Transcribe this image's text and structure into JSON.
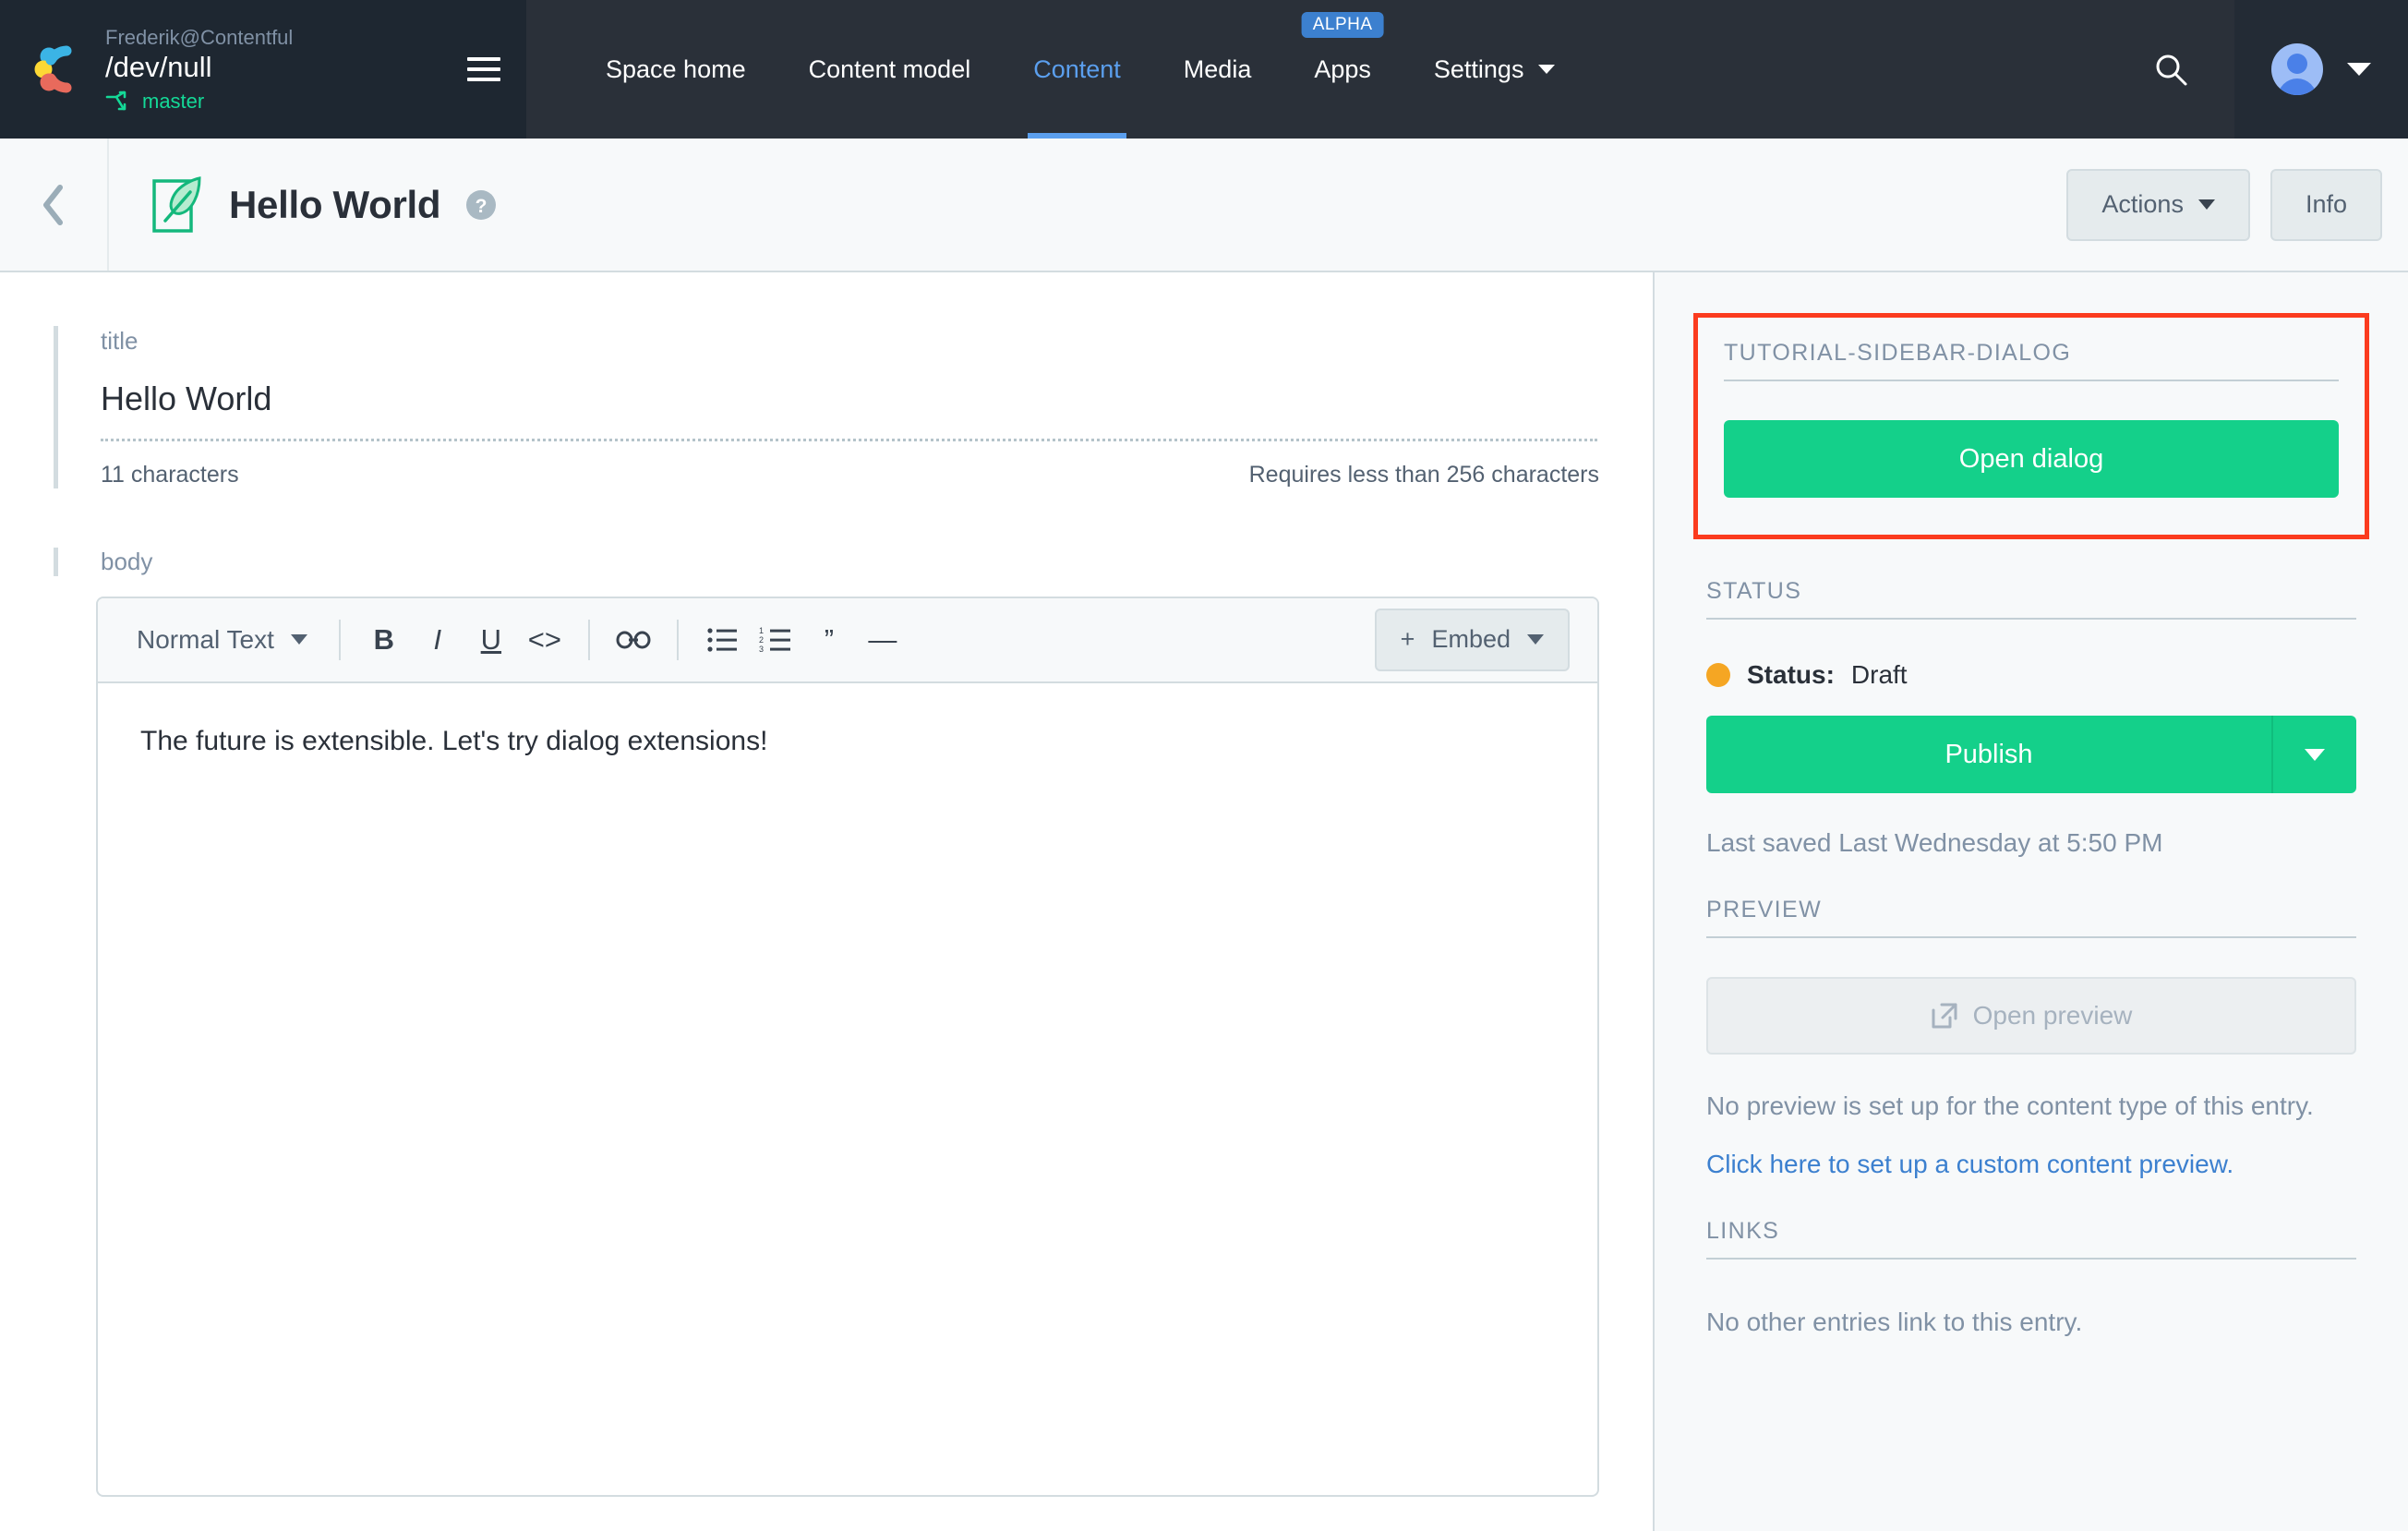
{
  "topnav": {
    "org": "Frederik@Contentful",
    "space_name": "/dev/null",
    "branch": "master",
    "menu_icon": "hamburger-icon",
    "items": [
      {
        "label": "Space home",
        "active": false
      },
      {
        "label": "Content model",
        "active": false
      },
      {
        "label": "Content",
        "active": true
      },
      {
        "label": "Media",
        "active": false
      },
      {
        "label": "Apps",
        "active": false,
        "badge": "ALPHA"
      },
      {
        "label": "Settings",
        "active": false,
        "caret": true
      }
    ],
    "search_icon": "search-icon",
    "avatar_icon": "user-avatar-icon"
  },
  "subheader": {
    "back_icon": "chevron-left-icon",
    "entry_icon": "entry-quill-icon",
    "entry_title": "Hello World",
    "help_icon": "help-circle-icon",
    "actions_label": "Actions",
    "info_label": "Info"
  },
  "fields": {
    "title": {
      "label": "title",
      "value": "Hello World",
      "char_count": "11 characters",
      "constraint": "Requires less than 256 characters"
    },
    "body": {
      "label": "body",
      "content": "The future is extensible. Let's try dialog extensions!",
      "toolbar": {
        "style_label": "Normal Text",
        "buttons": [
          {
            "name": "bold-icon",
            "glyph": "B"
          },
          {
            "name": "italic-icon",
            "glyph": "I"
          },
          {
            "name": "underline-icon",
            "glyph": "U"
          },
          {
            "name": "code-icon",
            "glyph": "<>"
          },
          {
            "name": "link-icon",
            "glyph": "link"
          },
          {
            "name": "bulleted-list-icon",
            "glyph": "ul"
          },
          {
            "name": "numbered-list-icon",
            "glyph": "ol"
          },
          {
            "name": "blockquote-icon",
            "glyph": "”"
          },
          {
            "name": "horizontal-rule-icon",
            "glyph": "—"
          }
        ],
        "embed_label": "Embed"
      }
    }
  },
  "sidebar": {
    "tutorial": {
      "heading": "TUTORIAL-SIDEBAR-DIALOG",
      "button_label": "Open dialog",
      "highlight_color": "#fb3b1e"
    },
    "status": {
      "heading": "STATUS",
      "label": "Status:",
      "value": "Draft",
      "dot_color": "#f5a623",
      "publish_label": "Publish",
      "last_saved": "Last saved Last Wednesday at 5:50 PM"
    },
    "preview": {
      "heading": "PREVIEW",
      "button_label": "Open preview",
      "button_icon": "external-link-icon",
      "note": "No preview is set up for the content type of this entry.",
      "link": "Click here to set up a custom content preview."
    },
    "links": {
      "heading": "LINKS",
      "empty": "No other entries link to this entry."
    }
  },
  "colors": {
    "accent_green": "#14d08a",
    "accent_blue": "#5b9fee",
    "nav_bg": "#2a3039",
    "space_bg": "#1e2731"
  }
}
